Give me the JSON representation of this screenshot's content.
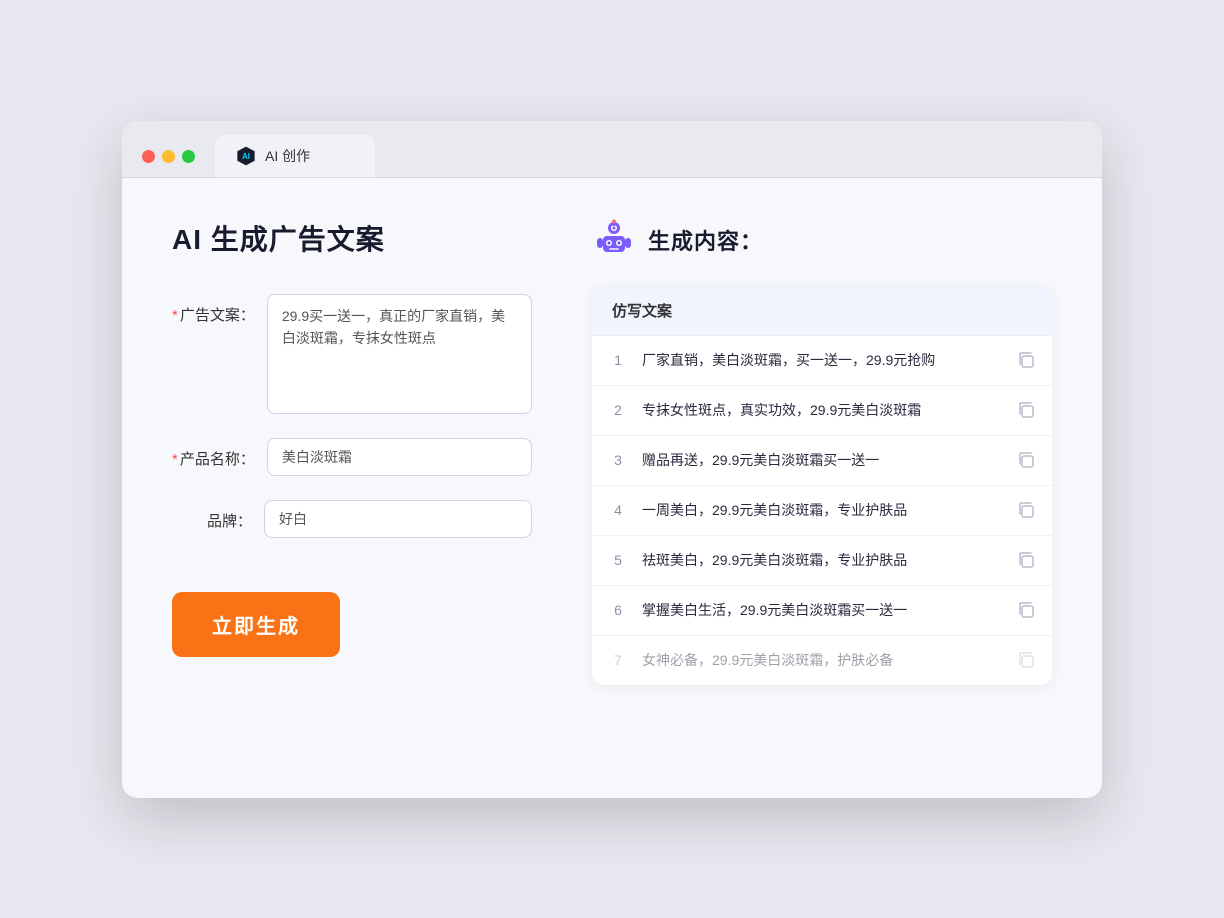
{
  "browser": {
    "tab_label": "AI 创作"
  },
  "page": {
    "title": "AI 生成广告文案",
    "right_title": "生成内容："
  },
  "form": {
    "ad_copy_label": "广告文案：",
    "ad_copy_required": true,
    "ad_copy_value": "29.9买一送一，真正的厂家直销，美白淡斑霜，专抹女性斑点",
    "product_name_label": "产品名称：",
    "product_name_required": true,
    "product_name_value": "美白淡斑霜",
    "brand_label": "品牌：",
    "brand_required": false,
    "brand_value": "好白",
    "generate_button": "立即生成"
  },
  "results": {
    "table_header": "仿写文案",
    "items": [
      {
        "index": 1,
        "text": "厂家直销，美白淡斑霜，买一送一，29.9元抢购",
        "dimmed": false
      },
      {
        "index": 2,
        "text": "专抹女性斑点，真实功效，29.9元美白淡斑霜",
        "dimmed": false
      },
      {
        "index": 3,
        "text": "赠品再送，29.9元美白淡斑霜买一送一",
        "dimmed": false
      },
      {
        "index": 4,
        "text": "一周美白，29.9元美白淡斑霜，专业护肤品",
        "dimmed": false
      },
      {
        "index": 5,
        "text": "祛斑美白，29.9元美白淡斑霜，专业护肤品",
        "dimmed": false
      },
      {
        "index": 6,
        "text": "掌握美白生活，29.9元美白淡斑霜买一送一",
        "dimmed": false
      },
      {
        "index": 7,
        "text": "女神必备，29.9元美白淡斑霜，护肤必备",
        "dimmed": true
      }
    ]
  }
}
